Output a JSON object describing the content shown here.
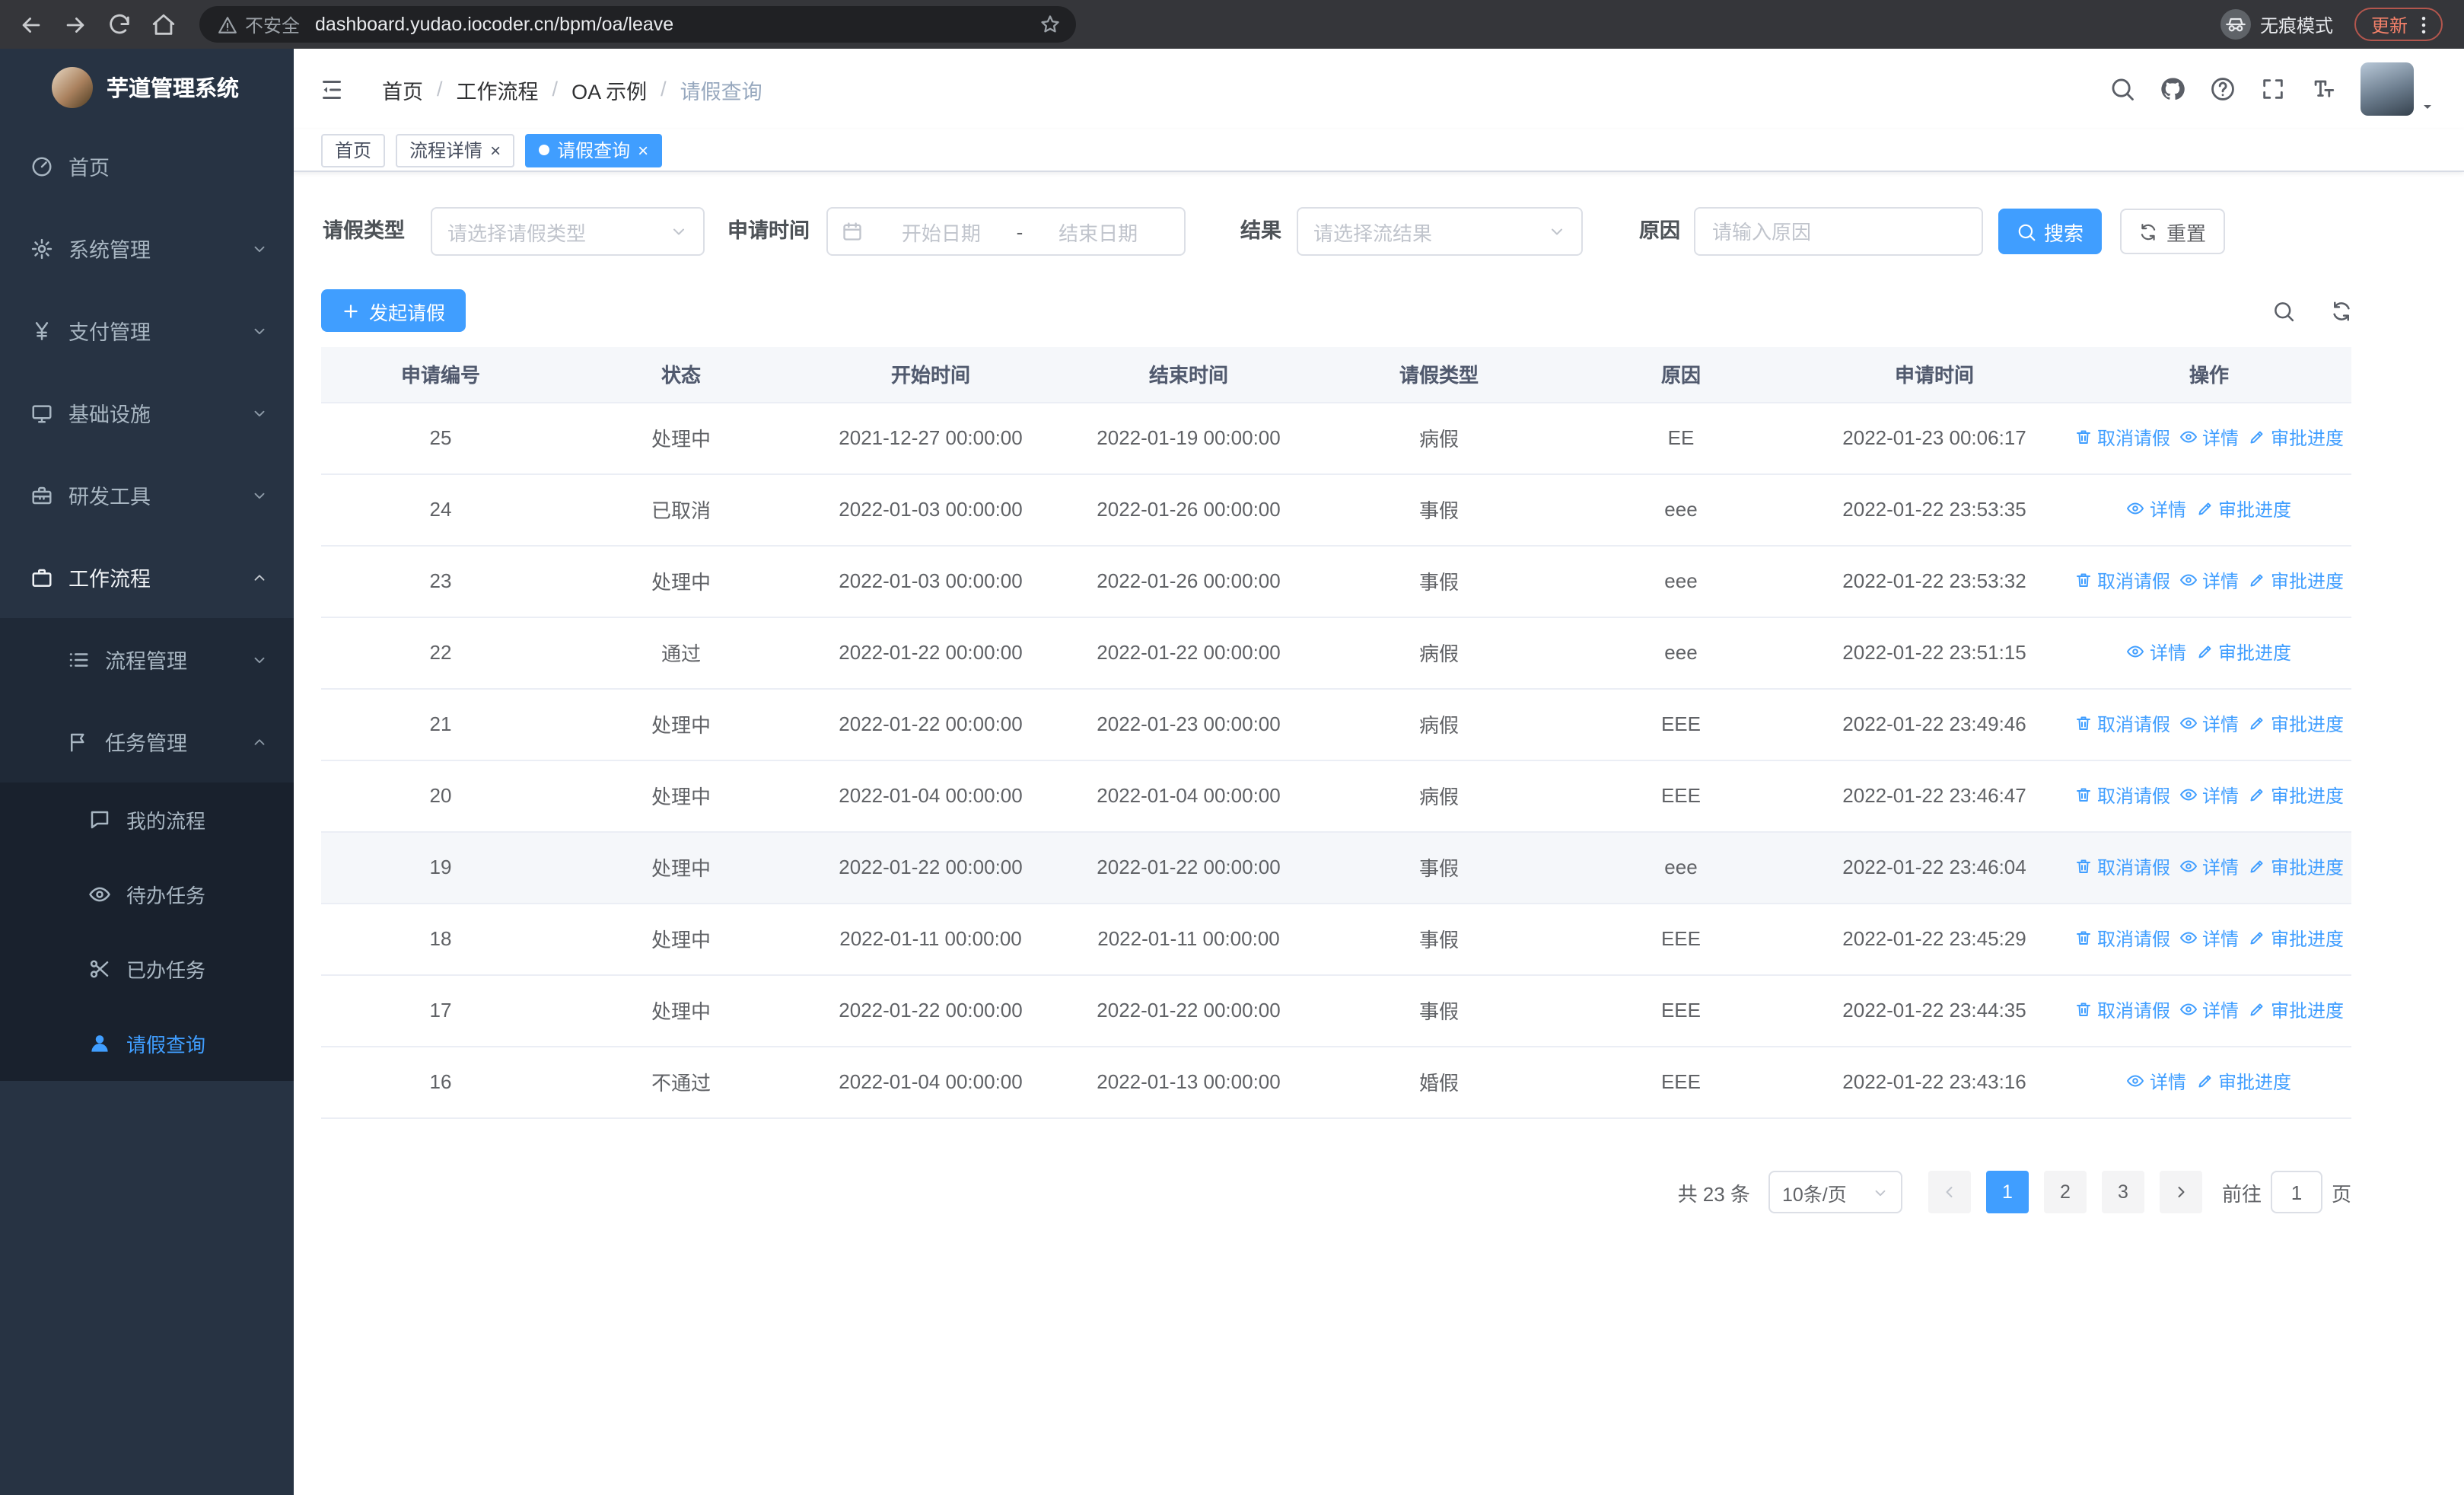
{
  "colors": {
    "accent": "#409eff",
    "sidebar_bg": "#273343",
    "chrome_bg": "#35363a",
    "link": "#409eff"
  },
  "browser": {
    "security_label": "不安全",
    "url": "dashboard.yudao.iocoder.cn/bpm/oa/leave",
    "incognito_label": "无痕模式",
    "update_label": "更新"
  },
  "sidebar": {
    "logo_title": "芋道管理系统",
    "menu": [
      {
        "label": "首页",
        "icon": "gauge"
      },
      {
        "label": "系统管理",
        "icon": "gear",
        "chevron": "down"
      },
      {
        "label": "支付管理",
        "icon": "yen",
        "chevron": "down"
      },
      {
        "label": "基础设施",
        "icon": "monitor",
        "chevron": "down"
      },
      {
        "label": "研发工具",
        "icon": "toolbox",
        "chevron": "down"
      },
      {
        "label": "工作流程",
        "icon": "briefcase",
        "chevron": "up",
        "parent_active": true,
        "children": [
          {
            "label": "流程管理",
            "icon": "list",
            "chevron": "down"
          },
          {
            "label": "任务管理",
            "icon": "flag",
            "chevron": "up",
            "children": [
              {
                "label": "我的流程",
                "icon": "chat"
              },
              {
                "label": "待办任务",
                "icon": "eye"
              },
              {
                "label": "已办任务",
                "icon": "scissors"
              },
              {
                "label": "请假查询",
                "icon": "user",
                "active": true
              }
            ]
          }
        ]
      }
    ]
  },
  "header": {
    "breadcrumb": [
      "首页",
      "工作流程",
      "OA 示例",
      "请假查询"
    ]
  },
  "tabs": [
    {
      "label": "首页",
      "closable": false,
      "active": false
    },
    {
      "label": "流程详情",
      "closable": true,
      "active": false
    },
    {
      "label": "请假查询",
      "closable": true,
      "active": true
    }
  ],
  "filters": {
    "leave_type_label": "请假类型",
    "leave_type_placeholder": "请选择请假类型",
    "apply_time_label": "申请时间",
    "start_placeholder": "开始日期",
    "separator": "-",
    "end_placeholder": "结束日期",
    "result_label": "结果",
    "result_placeholder": "请选择流结果",
    "reason_label": "原因",
    "reason_placeholder": "请输入原因",
    "search_label": "搜索",
    "reset_label": "重置"
  },
  "toolbar": {
    "create_label": "发起请假"
  },
  "table": {
    "columns": [
      "申请编号",
      "状态",
      "开始时间",
      "结束时间",
      "请假类型",
      "原因",
      "申请时间",
      "操作"
    ],
    "action_labels": {
      "cancel": "取消请假",
      "detail": "详情",
      "progress": "审批进度"
    },
    "rows": [
      {
        "id": "25",
        "status": "处理中",
        "start": "2021-12-27 00:00:00",
        "end": "2022-01-19 00:00:00",
        "type": "病假",
        "reason": "EE",
        "applied": "2022-01-23 00:06:17",
        "actions": [
          "cancel",
          "detail",
          "progress"
        ]
      },
      {
        "id": "24",
        "status": "已取消",
        "start": "2022-01-03 00:00:00",
        "end": "2022-01-26 00:00:00",
        "type": "事假",
        "reason": "eee",
        "applied": "2022-01-22 23:53:35",
        "actions": [
          "detail",
          "progress"
        ]
      },
      {
        "id": "23",
        "status": "处理中",
        "start": "2022-01-03 00:00:00",
        "end": "2022-01-26 00:00:00",
        "type": "事假",
        "reason": "eee",
        "applied": "2022-01-22 23:53:32",
        "actions": [
          "cancel",
          "detail",
          "progress"
        ]
      },
      {
        "id": "22",
        "status": "通过",
        "start": "2022-01-22 00:00:00",
        "end": "2022-01-22 00:00:00",
        "type": "病假",
        "reason": "eee",
        "applied": "2022-01-22 23:51:15",
        "actions": [
          "detail",
          "progress"
        ]
      },
      {
        "id": "21",
        "status": "处理中",
        "start": "2022-01-22 00:00:00",
        "end": "2022-01-23 00:00:00",
        "type": "病假",
        "reason": "EEE",
        "applied": "2022-01-22 23:49:46",
        "actions": [
          "cancel",
          "detail",
          "progress"
        ]
      },
      {
        "id": "20",
        "status": "处理中",
        "start": "2022-01-04 00:00:00",
        "end": "2022-01-04 00:00:00",
        "type": "病假",
        "reason": "EEE",
        "applied": "2022-01-22 23:46:47",
        "actions": [
          "cancel",
          "detail",
          "progress"
        ]
      },
      {
        "id": "19",
        "status": "处理中",
        "start": "2022-01-22 00:00:00",
        "end": "2022-01-22 00:00:00",
        "type": "事假",
        "reason": "eee",
        "applied": "2022-01-22 23:46:04",
        "actions": [
          "cancel",
          "detail",
          "progress"
        ],
        "highlighted": true
      },
      {
        "id": "18",
        "status": "处理中",
        "start": "2022-01-11 00:00:00",
        "end": "2022-01-11 00:00:00",
        "type": "事假",
        "reason": "EEE",
        "applied": "2022-01-22 23:45:29",
        "actions": [
          "cancel",
          "detail",
          "progress"
        ]
      },
      {
        "id": "17",
        "status": "处理中",
        "start": "2022-01-22 00:00:00",
        "end": "2022-01-22 00:00:00",
        "type": "事假",
        "reason": "EEE",
        "applied": "2022-01-22 23:44:35",
        "actions": [
          "cancel",
          "detail",
          "progress"
        ]
      },
      {
        "id": "16",
        "status": "不通过",
        "start": "2022-01-04 00:00:00",
        "end": "2022-01-13 00:00:00",
        "type": "婚假",
        "reason": "EEE",
        "applied": "2022-01-22 23:43:16",
        "actions": [
          "detail",
          "progress"
        ]
      }
    ]
  },
  "pagination": {
    "total_label": "共 23 条",
    "page_size_label": "10条/页",
    "pages": [
      "1",
      "2",
      "3"
    ],
    "active_page": "1",
    "goto_label": "前往",
    "goto_value": "1",
    "page_unit": "页"
  }
}
